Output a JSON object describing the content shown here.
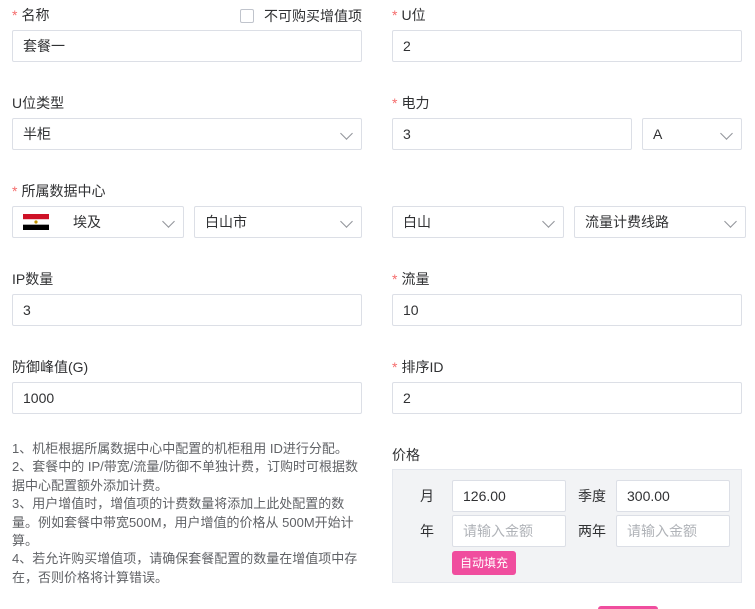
{
  "name": {
    "label": "名称",
    "value": "套餐一"
  },
  "no_addon": {
    "label": "不可购买增值项"
  },
  "u_pos": {
    "label": "U位",
    "value": "2"
  },
  "u_type": {
    "label": "U位类型",
    "value": "半柜"
  },
  "power": {
    "label": "电力",
    "value": "3",
    "unit": "A"
  },
  "datacenter": {
    "label": "所属数据中心",
    "country": "埃及",
    "city": "白山市",
    "dc": "白山",
    "line": "流量计费线路"
  },
  "ip_count": {
    "label": "IP数量",
    "value": "3"
  },
  "traffic": {
    "label": "流量",
    "value": "10"
  },
  "defense": {
    "label": "防御峰值(G)",
    "value": "1000"
  },
  "sort_id": {
    "label": "排序ID",
    "value": "2"
  },
  "notes": {
    "line1": "1、机柜根据所属数据中心中配置的机柜租用 ID进行分配。",
    "line2": "2、套餐中的 IP/带宽/流量/防御不单独计费，订购时可根据数据中心配置额外添加计费。",
    "line3": "3、用户增值时，增值项的计费数量将添加上此处配置的数量。例如套餐中带宽500M，用户增值的价格从 500M开始计算。",
    "line4": "4、若允许购买增值项，请确保套餐配置的数量在增值项中存在，否则价格将计算错误。"
  },
  "price": {
    "label": "价格",
    "month_label": "月",
    "month_value": "126.00",
    "quarter_label": "季度",
    "quarter_value": "300.00",
    "year_label": "年",
    "year_placeholder": "请输入金额",
    "biennial_label": "两年",
    "biennial_placeholder": "请输入金额",
    "autofill_label": "自动填充"
  },
  "colors": {
    "required": "#f56c6c",
    "accent": "#f04d9e"
  }
}
